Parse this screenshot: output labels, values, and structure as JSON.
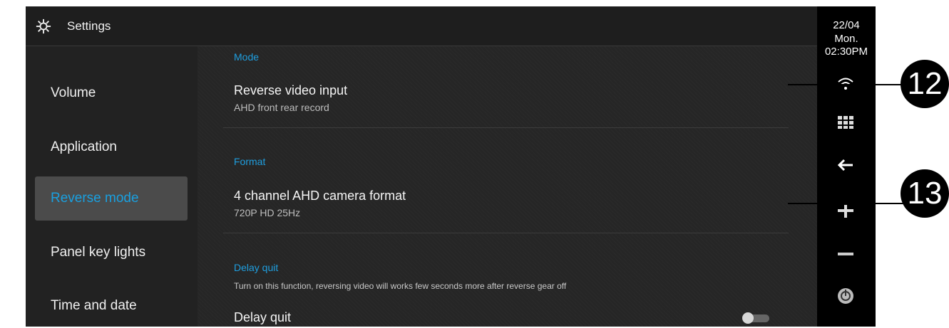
{
  "header": {
    "title": "Settings",
    "icon": "gear-icon"
  },
  "sidebar": {
    "items": [
      {
        "label": "Volume"
      },
      {
        "label": "Application"
      },
      {
        "label": "Reverse mode",
        "active": true
      },
      {
        "label": "Panel key lights"
      },
      {
        "label": "Time and date"
      }
    ]
  },
  "content": {
    "mode": {
      "section_label": "Mode",
      "title": "Reverse video input",
      "subtitle": "AHD front rear record"
    },
    "format": {
      "section_label": "Format",
      "title": "4 channel AHD camera format",
      "subtitle": "720P HD 25Hz"
    },
    "delay": {
      "section_label": "Delay quit",
      "description": "Turn on this function, reversing video will works few seconds more after reverse gear off",
      "title": "Delay quit",
      "toggle_on": false
    }
  },
  "status_rail": {
    "date": "22/04",
    "day": "Mon.",
    "time": "02:30PM",
    "icons": [
      "wifi-icon",
      "apps-grid-icon",
      "back-arrow-icon",
      "navigation-icon",
      "minus-icon",
      "power-icon"
    ]
  },
  "callouts": [
    {
      "label": "12"
    },
    {
      "label": "13"
    }
  ],
  "colors": {
    "accent": "#19a0e0",
    "background": "#262626",
    "rail": "#000000"
  }
}
